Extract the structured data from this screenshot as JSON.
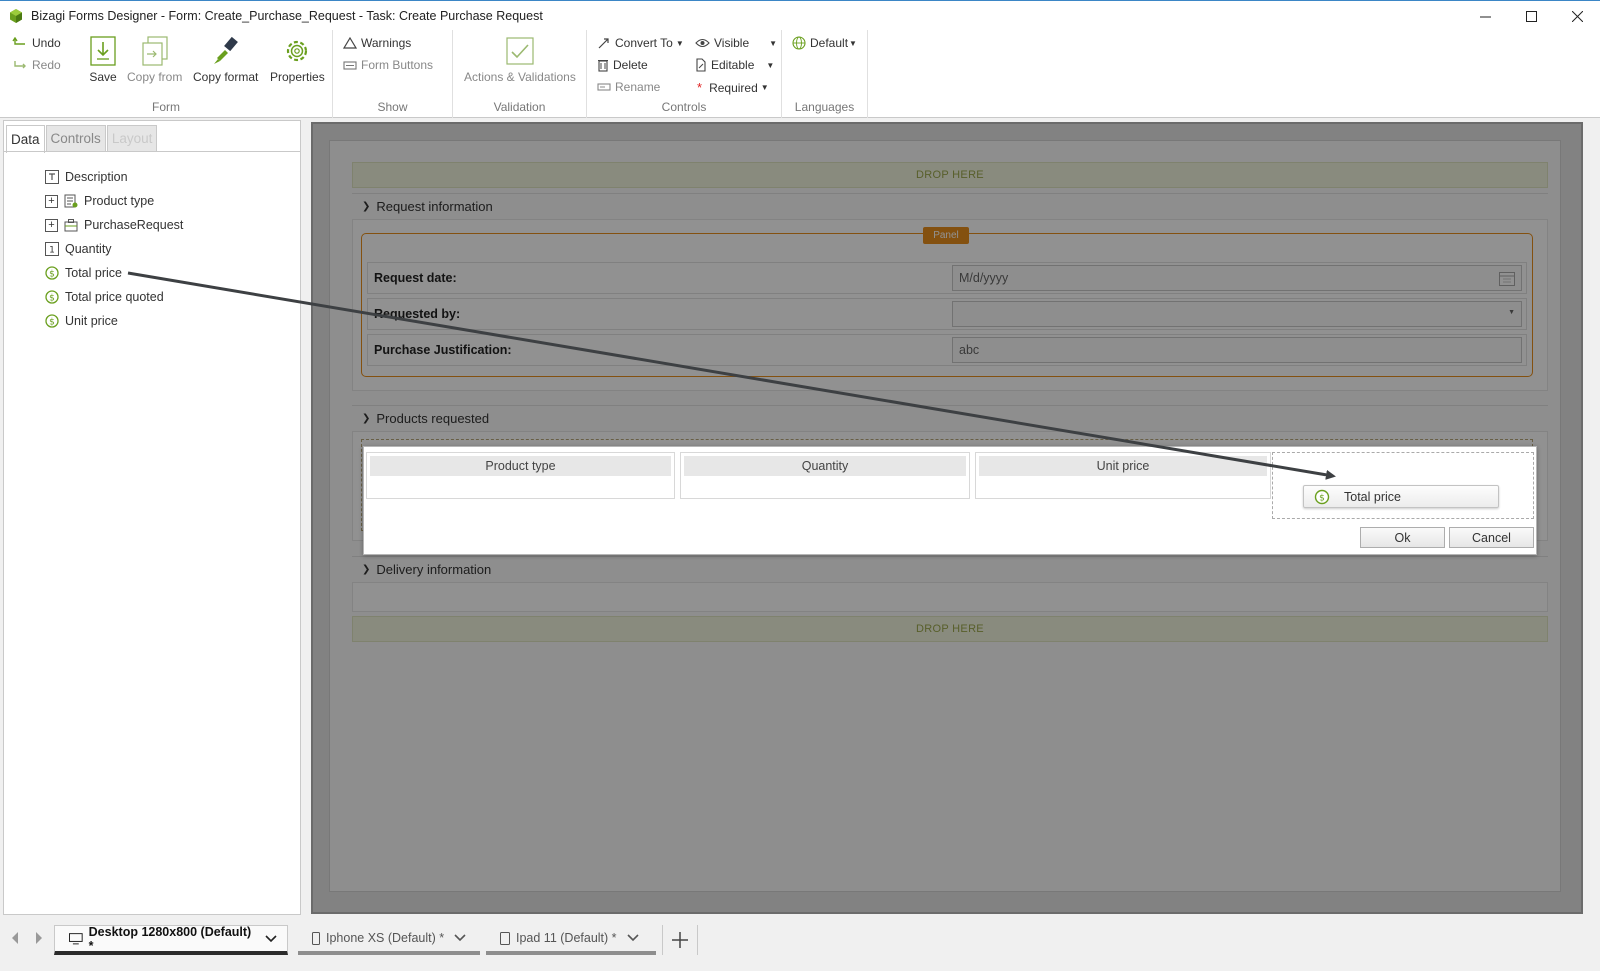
{
  "window": {
    "title": "Bizagi Forms Designer  - Form: Create_Purchase_Request - Task:  Create Purchase Request"
  },
  "ribbon": {
    "form_group": {
      "label": "Form",
      "undo": "Undo",
      "redo": "Redo",
      "save": "Save",
      "copy_from": "Copy from",
      "copy_format": "Copy format",
      "properties": "Properties"
    },
    "show_group": {
      "label": "Show",
      "warnings": "Warnings",
      "form_buttons": "Form Buttons"
    },
    "validation_group": {
      "label": "Validation",
      "actions_validations": "Actions & Validations"
    },
    "controls_group": {
      "label": "Controls",
      "convert_to": "Convert To",
      "delete": "Delete",
      "rename": "Rename",
      "visible": "Visible",
      "editable": "Editable",
      "required": "Required"
    },
    "languages_group": {
      "label": "Languages",
      "default": "Default"
    }
  },
  "left_panel": {
    "tabs": [
      {
        "label": "Data"
      },
      {
        "label": "Controls"
      },
      {
        "label": "Layout"
      }
    ],
    "tree": [
      {
        "label": "Description",
        "icon": "text-field-icon"
      },
      {
        "label": "Product type",
        "icon": "entity-list-icon",
        "expandable": true
      },
      {
        "label": "PurchaseRequest",
        "icon": "entity-icon",
        "expandable": true
      },
      {
        "label": "Quantity",
        "icon": "integer-icon"
      },
      {
        "label": "Total price",
        "icon": "currency-icon"
      },
      {
        "label": "Total price quoted",
        "icon": "currency-icon"
      },
      {
        "label": "Unit price",
        "icon": "currency-icon"
      }
    ]
  },
  "canvas": {
    "drop_here": "DROP HERE",
    "groups": {
      "request_info": "Request information",
      "products_requested": "Products requested",
      "delivery_info": "Delivery information"
    },
    "panel_tag": "Panel",
    "fields": {
      "request_date": {
        "label": "Request date:",
        "placeholder": "M/d/yyyy"
      },
      "requested_by": {
        "label": "Requested by:",
        "value": ""
      },
      "purchase_justification": {
        "label": "Purchase Justification:",
        "value": "abc"
      }
    }
  },
  "dialog": {
    "columns": [
      "Product type",
      "Quantity",
      "Unit price"
    ],
    "dragged_item": "Total price",
    "ok": "Ok",
    "cancel": "Cancel"
  },
  "bottom_tabs": {
    "tabs": [
      {
        "label": "Desktop 1280x800 (Default) *",
        "active": true
      },
      {
        "label": "Iphone XS (Default) *",
        "active": false
      },
      {
        "label": "Ipad 11 (Default) *",
        "active": false
      }
    ]
  },
  "colors": {
    "accent_green": "#6a9f1e",
    "panel_orange": "#e88f1d",
    "drop_zone_text": "#9ba84c"
  }
}
